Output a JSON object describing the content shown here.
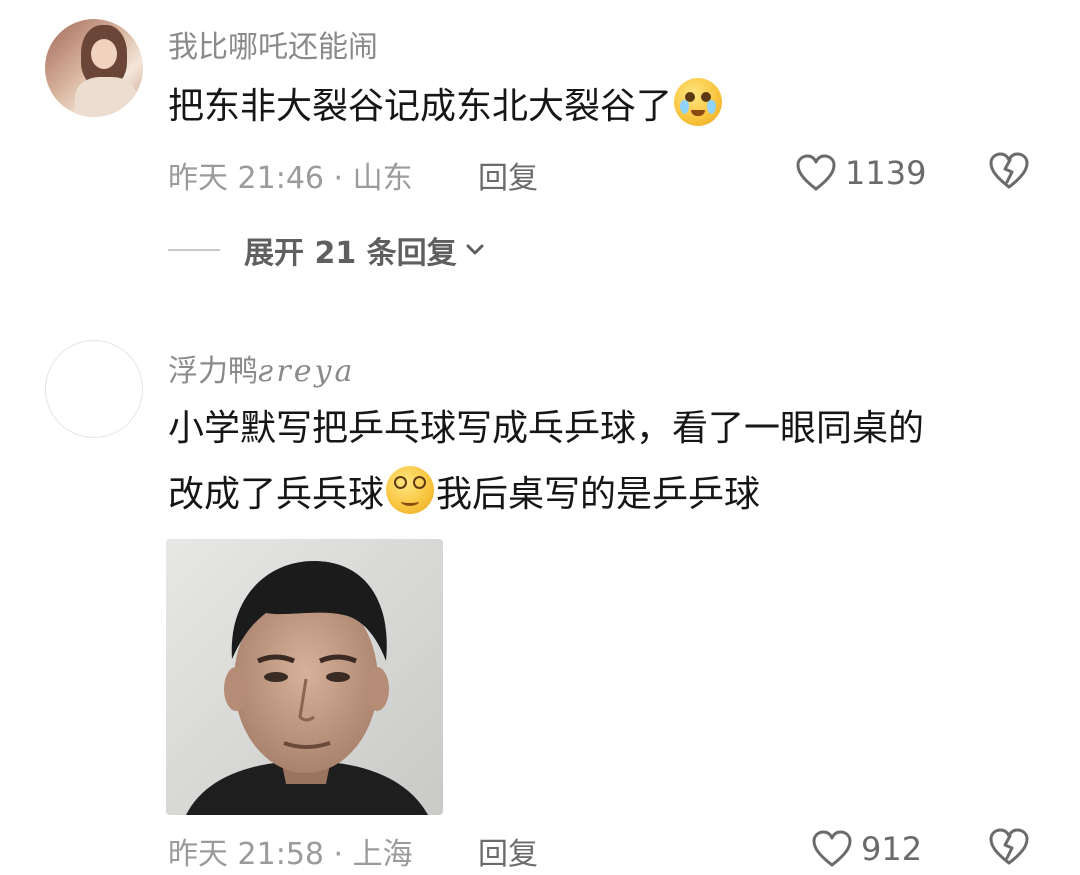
{
  "comments": [
    {
      "username": "我比哪吒还能闹",
      "content_pre": "把东非大裂谷记成东北大裂谷了",
      "emoji_1": "crying-face-emoji",
      "time_location": "昨天 21:46 · 山东",
      "reply_label": "回复",
      "likes": "1139",
      "expand_label": "展开 21 条回复"
    },
    {
      "username": "浮力鸭",
      "username_fancy": "ƨreya",
      "content_line1": "小学默写把乒乓球写成乓乒球，看了一眼同桌的",
      "content_line2_pre": "改成了兵兵球",
      "emoji_2": "dizzy-face-emoji",
      "content_line2_post": "我后桌写的是乒乒球",
      "image": "meme-man-photo",
      "time_location": "昨天 21:58 · 上海",
      "reply_label": "回复",
      "likes": "912"
    }
  ],
  "colors": {
    "meta_gray": "#9b9b9b",
    "text": "#161616",
    "background": "#ffffff"
  }
}
